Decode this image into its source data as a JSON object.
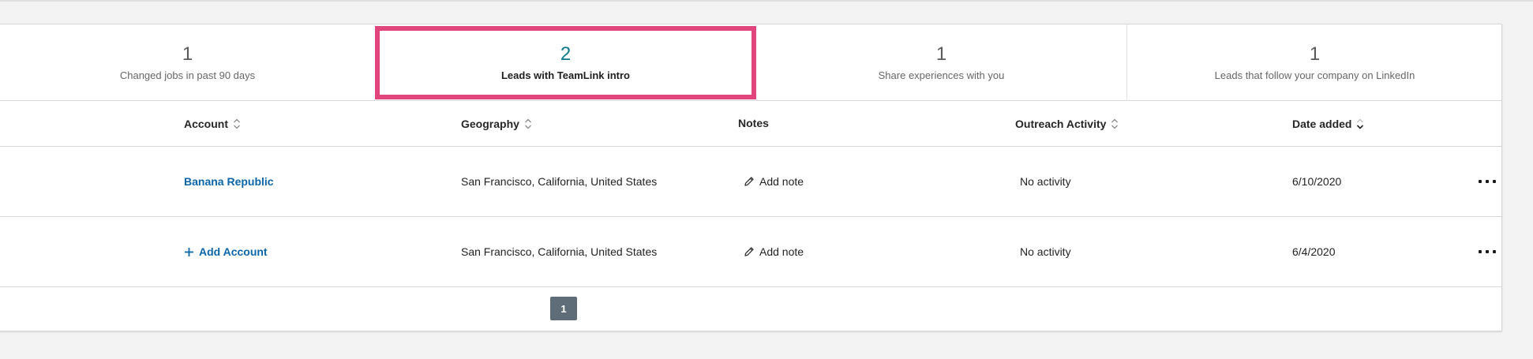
{
  "filters": [
    {
      "count": "1",
      "label": "Changed jobs in past 90 days"
    },
    {
      "count": "2",
      "label": "Leads with TeamLink intro"
    },
    {
      "count": "1",
      "label": "Share experiences with you"
    },
    {
      "count": "1",
      "label": "Leads that follow your company on LinkedIn"
    }
  ],
  "columns": {
    "account": "Account",
    "geography": "Geography",
    "notes": "Notes",
    "outreach": "Outreach Activity",
    "date_added": "Date added"
  },
  "rows": [
    {
      "account": "Banana Republic",
      "geography": "San Francisco, California, United States",
      "notes": "Add note",
      "outreach": "No activity",
      "date_added": "6/10/2020"
    },
    {
      "account": "Add Account",
      "geography": "San Francisco, California, United States",
      "notes": "Add note",
      "outreach": "No activity",
      "date_added": "6/4/2020"
    }
  ],
  "pagination": {
    "current_page": "1"
  },
  "colors": {
    "accent_teal": "#0e7a8a",
    "link_blue": "#0a66a8",
    "highlight_pink": "#e0457b",
    "pager_bg": "#5e6d77"
  },
  "icons": {
    "sort": "sort-icon",
    "sort_active": "sort-desc-icon",
    "edit": "pencil-icon",
    "plus": "plus-icon",
    "more": "more-icon"
  }
}
